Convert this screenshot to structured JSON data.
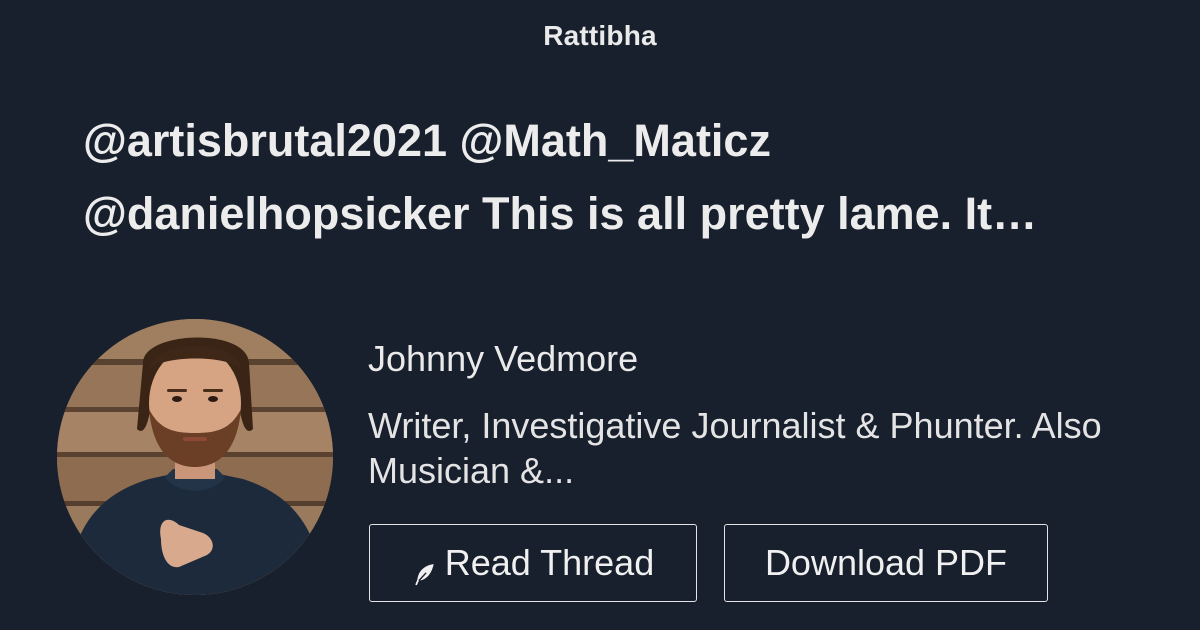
{
  "brand": {
    "name": "Rattibha"
  },
  "thread": {
    "title_lines": [
      "@artisbrutal2021 @Math_Maticz",
      "@danielhopsicker This is all pretty lame. It…"
    ]
  },
  "author": {
    "name": "Johnny Vedmore",
    "bio_lines": [
      "Writer, Investigative Journalist & Phunter. Also",
      "Musician &..."
    ]
  },
  "actions": {
    "read_thread_label": "Read Thread",
    "read_thread_icon": "feather-icon",
    "download_pdf_label": "Download PDF"
  },
  "colors": {
    "background": "#18202d",
    "text": "#eaeaea",
    "button_border": "#e4e4e4"
  }
}
